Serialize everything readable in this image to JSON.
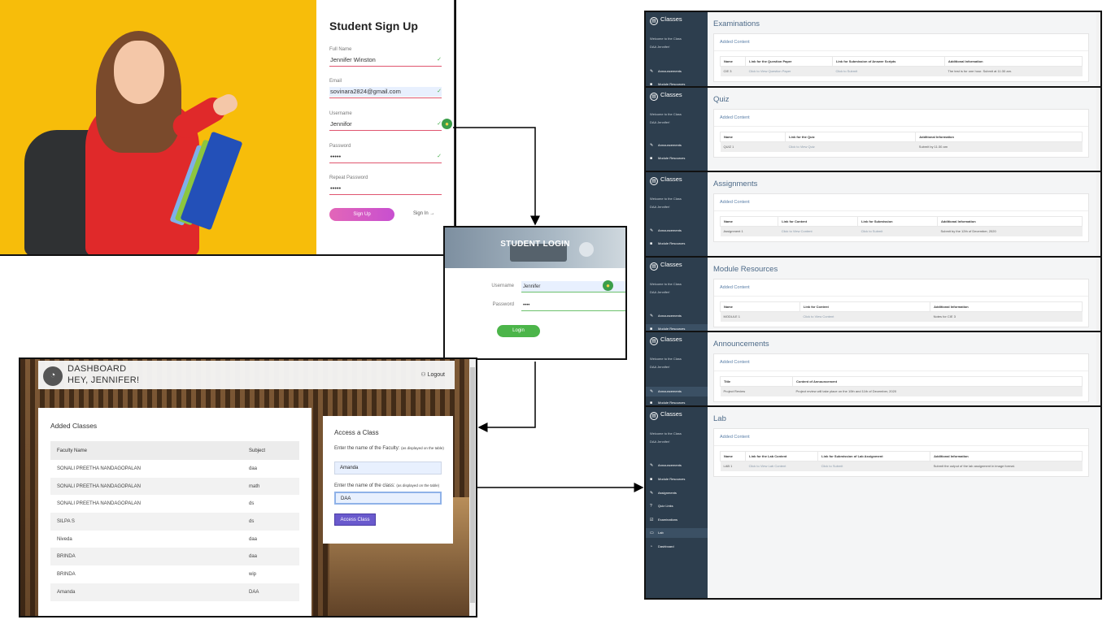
{
  "signup": {
    "title": "Student Sign Up",
    "fields": [
      {
        "label": "Full Name",
        "value": "Jennifer Winston"
      },
      {
        "label": "Email",
        "value": "sovinara2824@gmail.com"
      },
      {
        "label": "Username",
        "value": "Jennifor"
      },
      {
        "label": "Password",
        "value": "•••••"
      },
      {
        "label": "Repeat Password",
        "value": "•••••"
      }
    ],
    "signup_button": "Sign Up",
    "signin_link": "Sign In →",
    "check_icon": "✓",
    "bulb_icon": "💡"
  },
  "login": {
    "title": "STUDENT LOGIN",
    "username_label": "Username",
    "username_value": "Jennifer",
    "password_label": "Password",
    "password_value": "••••",
    "login_button": "Login"
  },
  "dashboard": {
    "title_line1": "DASHBOARD",
    "title_line2": "HEY, JENNIFER!",
    "logout": "Logout",
    "added_classes": {
      "title": "Added Classes",
      "columns": [
        "Faculty Name",
        "Subject"
      ],
      "rows": [
        [
          "SONALI PREETHA NANDAGOPALAN",
          "daa"
        ],
        [
          "SONALI PREETHA NANDAGOPALAN",
          "math"
        ],
        [
          "SONALI PREETHA NANDAGOPALAN",
          "ds"
        ],
        [
          "SILPA S",
          "ds"
        ],
        [
          "Niveda",
          "daa"
        ],
        [
          "BRINDA",
          "daa"
        ],
        [
          "BRINDA",
          "wip"
        ],
        [
          "Amanda",
          "DAA"
        ]
      ]
    },
    "access": {
      "title": "Access a Class",
      "faculty_label": "Enter the name of the Faculty:",
      "faculty_hint": "(as displayed on the table)",
      "faculty_value": "Amanda",
      "class_label": "Enter the name of the class:",
      "class_hint": "(as displayed on the table)",
      "class_value": "DAA",
      "button": "Access Class"
    }
  },
  "classes": {
    "brand": "Classes",
    "welcome_1": "Welcome to the Class",
    "welcome_2": "DAA Jennifer!",
    "card_header": "Added Content",
    "nav": [
      "Announcements",
      "Module Resources",
      "Assignments",
      "Quiz Links",
      "Examinations",
      "Lab",
      "Dashboard"
    ],
    "panels": [
      {
        "title": "Examinations",
        "columns": [
          "Name",
          "Link for the Question Paper",
          "Link for Submission of Answer Scripts",
          "Additional Information"
        ],
        "row": [
          "CIE 3",
          "Click to View Question Paper",
          "Click to Submit",
          "The test is for one hour. Submit at 11:30 am."
        ]
      },
      {
        "title": "Quiz",
        "columns": [
          "Name",
          "Link for the Quiz",
          "Additional Information"
        ],
        "row": [
          "QUIZ 1",
          "Click to View Quiz",
          "Submit by 11:30 am"
        ]
      },
      {
        "title": "Assignments",
        "columns": [
          "Name",
          "Link for Content",
          "Link for Submission",
          "Additional Information"
        ],
        "row": [
          "Assignment 1",
          "Click to View Content",
          "Click to Submit",
          "Submit by the 12th of December, 2020"
        ]
      },
      {
        "title": "Module Resources",
        "columns": [
          "Name",
          "Link for Content",
          "Additional Information"
        ],
        "row": [
          "MODULE 1",
          "Click to View Content",
          "Notes for CIE 3"
        ]
      },
      {
        "title": "Announcements",
        "columns": [
          "Title",
          "Content of Announcement"
        ],
        "row": [
          "Project Review",
          "Project review will take place on the 10th and 11th of December, 2020"
        ]
      },
      {
        "title": "Lab",
        "columns": [
          "Name",
          "Link for the Lab Content",
          "Link for Submission of Lab Assignment",
          "Additional Information"
        ],
        "row": [
          "LAB 1",
          "Click to View Lab Content",
          "Click to Submit",
          "Submit the output of the lab assignment in image format."
        ]
      }
    ]
  },
  "colors": {
    "accent_pink": "#e266b8",
    "login_green": "#4cb54a",
    "sidebar_dark": "#2d3e4e",
    "access_button": "#6a5acd"
  }
}
